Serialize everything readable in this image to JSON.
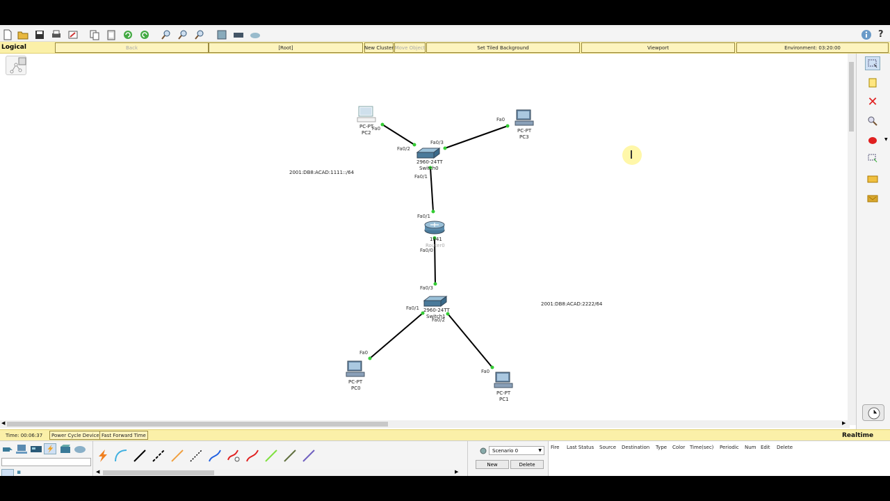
{
  "nav": {
    "mode_label": "Logical",
    "back": "Back",
    "root": "[Root]",
    "new_cluster": "New Cluster",
    "move_object": "Move Object",
    "set_tiled_background": "Set Tiled Background",
    "viewport": "Viewport",
    "environment": "Environment: 03:20:00"
  },
  "topology": {
    "devices": {
      "pc2": {
        "model": "PC-PT",
        "name": "PC2"
      },
      "pc3": {
        "model": "PC-PT",
        "name": "PC3"
      },
      "switch0": {
        "model": "2960-24TT",
        "name": "Switch0"
      },
      "router0": {
        "model": "1841",
        "name": "Router0"
      },
      "switch1": {
        "model": "2960-24TT",
        "name": "Switch1"
      },
      "pc0": {
        "model": "PC-PT",
        "name": "PC0"
      },
      "pc1": {
        "model": "PC-PT",
        "name": "PC1"
      }
    },
    "ports": {
      "pc2_fa0": "Fa0",
      "sw0_fa02": "Fa0/2",
      "sw0_fa03": "Fa0/3",
      "pc3_fa0": "Fa0",
      "sw0_fa01": "Fa0/1",
      "r0_fa01": "Fa0/1",
      "r0_fa00": "Fa0/0",
      "sw1_fa03": "Fa0/3",
      "sw1_fa01": "Fa0/1",
      "sw1_fa02": "Fa0/2",
      "pc0_fa0": "Fa0",
      "pc1_fa0": "Fa0"
    },
    "networks": {
      "top": "2001:DB8:ACAD:1111::/64",
      "bottom": "2001:DB8:ACAD:2222/64"
    },
    "link_color": "#000000",
    "link_up_color": "#33cc33"
  },
  "status": {
    "time": "Time: 00:06:37",
    "power_cycle": "Power Cycle Devices",
    "fast_forward": "Fast Forward Time",
    "realtime": "Realtime"
  },
  "scenario": {
    "selected": "Scenario 0",
    "new": "New",
    "delete": "Delete"
  },
  "pdu_columns": [
    "Fire",
    "Last Status",
    "Source",
    "Destination",
    "Type",
    "Color",
    "Time(sec)",
    "Periodic",
    "Num",
    "Edit",
    "Delete"
  ],
  "colors": {
    "nav_bg": "#fbf0a8",
    "delete_red": "#e02020",
    "cursor_highlight": "#fff6a0"
  }
}
